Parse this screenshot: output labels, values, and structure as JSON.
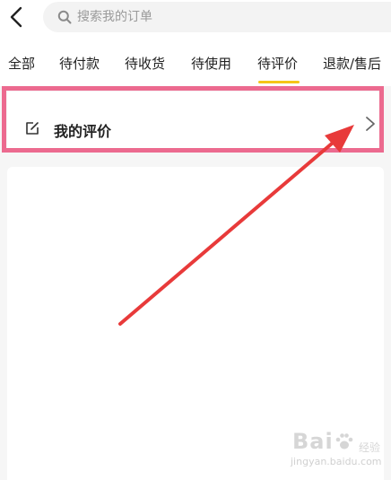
{
  "header": {
    "search": {
      "placeholder": "搜索我的订单",
      "value": ""
    }
  },
  "tabs": [
    {
      "label": "全部"
    },
    {
      "label": "待付款"
    },
    {
      "label": "待收货"
    },
    {
      "label": "待使用"
    },
    {
      "label": "待评价",
      "active": true
    },
    {
      "label": "退款/售后"
    }
  ],
  "review": {
    "label": "我的评价"
  },
  "watermark": {
    "logo": "Bai",
    "sub": "经验",
    "url": "jingyan.baidu.com"
  },
  "colors": {
    "accent": "#f5c518",
    "highlight": "#ec6a8f",
    "arrow": "#e83a3a"
  },
  "icons": [
    "back-arrow-icon",
    "search-icon",
    "edit-icon",
    "chevron-right-icon",
    "red-arrow-annotation",
    "paw-icon"
  ]
}
